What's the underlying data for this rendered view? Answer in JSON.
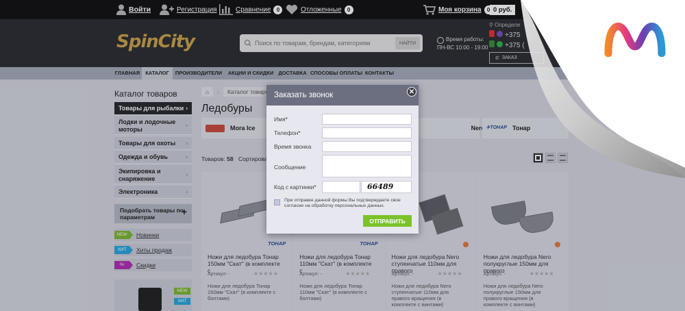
{
  "topbar": {
    "login": "Войти",
    "register": "Регистрация",
    "compare": "Сравнение",
    "compare_count": "0",
    "deferred": "Отложенные",
    "deferred_count": "0",
    "cart": "Моя корзина",
    "cart_count": "0",
    "cart_total": "0 руб."
  },
  "header": {
    "logo": "SpinCity",
    "search_placeholder": "Поиск по товарам, брендам, категориям",
    "search_button": "НАЙТИ",
    "hours_title": "Время работы:",
    "hours_value": "ПН-ВС 10:00 - 19:00",
    "city": "Определе",
    "phone1": "+375",
    "phone2": "+375 (",
    "call_button": "ЗАКАЗ"
  },
  "nav": [
    "ГЛАВНАЯ",
    "КАТАЛОГ",
    "ПРОИЗВОДИТЕЛИ",
    "АКЦИИ И СКИДКИ",
    "ДОСТАВКА",
    "СПОСОБЫ ОПЛАТЫ",
    "КОНТАКТЫ"
  ],
  "sidebar": {
    "title": "Каталог товаров",
    "items": [
      {
        "label": "Товары для рыбалки"
      },
      {
        "label": "Лодки и лодочные моторы"
      },
      {
        "label": "Товары для охоты"
      },
      {
        "label": "Одежда и обувь"
      },
      {
        "label": "Экипировка и снаряжение"
      },
      {
        "label": "Электроника"
      }
    ],
    "filter_button": "Подобрать товары по параметрам",
    "badges": [
      {
        "tag": "NEW",
        "label": "Новинки",
        "color": "#7bb631"
      },
      {
        "tag": "ХИТ",
        "label": "Хиты продаж",
        "color": "#2aa5dd"
      },
      {
        "tag": "%",
        "label": "Скидки",
        "color": "#b02fb3"
      }
    ],
    "promo_new": "NEW",
    "promo_hit": "ХИТ"
  },
  "main": {
    "breadcrumb": "Каталог товаров",
    "title": "Ледобуры",
    "brands": [
      {
        "name": "Mora Ice",
        "logo": "mora-logo"
      },
      {
        "name": "Nero",
        "logo": "nero-logo"
      },
      {
        "name": "Тонар",
        "logo": "tonar-logo"
      }
    ],
    "count_label": "Товаров:",
    "count": "58",
    "sort_label": "Сортироват",
    "products": [
      {
        "brand": "ТОНАР",
        "title": "Ножи для ледобура Тонар 150мм \"Скат\" (в комплекте с",
        "sku": "Артикул: -",
        "desc": "Ножи для ледобура Тонар 150мм \"Скат\" (в комплекте с болтами)"
      },
      {
        "brand": "ТОНАР",
        "title": "Ножи для ледобура Тонар 110мм \"Скат\" (в комплекте с",
        "sku": "Артикул: -",
        "desc": "Ножи для ледобура Тонар 110мм \"Скат\" (в комплекте с болтами)"
      },
      {
        "brand": "",
        "title": "Ножи для ледобура Nero ступенчатые 110мм для правого",
        "sku": "Артикул: -",
        "desc": "Ножи для ледобура Nero ступенчатые 110мм для правого вращения (в комплекте с винтами)"
      },
      {
        "brand": "",
        "title": "Ножи для ледобура Nero полукруглые 150мм для правого",
        "sku": "Артикул: -",
        "desc": "Ножи для ледобура Nero полукруглые 150мм для правого вращения (в комплекте с винтами)"
      }
    ]
  },
  "modal": {
    "title": "Заказать звонок",
    "close": "✕",
    "fields": [
      "Имя*",
      "Телефон*",
      "Время звонка",
      "Сообщение",
      "Код с картинки*"
    ],
    "captcha": "66489",
    "consent": "При отправке данной формы Вы подтверждаете свое согласие на обработку персональных данных.",
    "submit": "ОТПРАВИТЬ"
  },
  "colors": {
    "accent_green": "#7cc22a",
    "header_bg": "#2b2c30",
    "nav_bg": "#a3aab7"
  }
}
